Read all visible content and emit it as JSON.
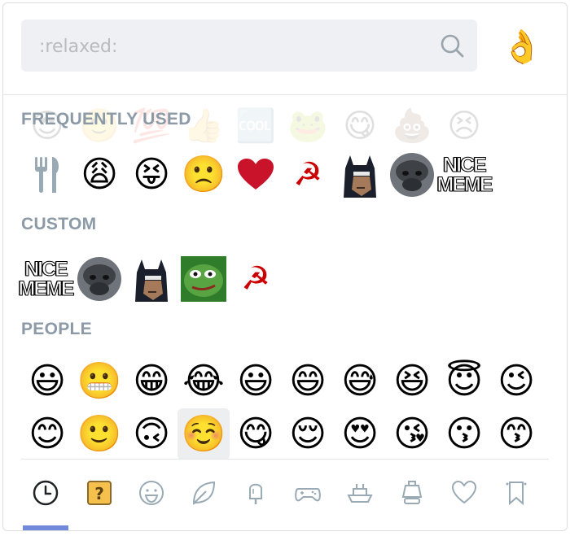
{
  "search": {
    "placeholder": ":relaxed:",
    "value": ""
  },
  "preview_emoji": "👌",
  "sections": {
    "frequently_used": {
      "label": "FREQUENTLY USED",
      "emojis": [
        "🍴",
        "😩",
        "😝",
        "🙁",
        "❤️"
      ],
      "faded_emojis": [
        "😍",
        "🙂",
        "💯",
        "👍",
        "🆒",
        "🐸",
        "😋",
        "💩",
        "😣"
      ]
    },
    "custom": {
      "label": "CUSTOM"
    },
    "people": {
      "label": "PEOPLE",
      "row1": [
        "😃",
        "😬",
        "😁",
        "😂",
        "😃",
        "😄",
        "😅",
        "😆",
        "😇",
        "😉"
      ],
      "row2": [
        "😊",
        "🙂",
        "🙃",
        "☺️",
        "😋",
        "😌",
        "😍",
        "😘",
        "😗",
        "😙"
      ]
    }
  },
  "custom_text": {
    "nice": "NICE",
    "meme": "MEME",
    "hammer_sickle": "☭"
  },
  "tabs": [
    "recent",
    "custom",
    "people",
    "nature",
    "food",
    "activity",
    "travel",
    "objects",
    "symbols",
    "flags"
  ],
  "colors": {
    "accent": "#7289da",
    "header": "#8b9aa6",
    "search_bg": "#eef0f3"
  }
}
